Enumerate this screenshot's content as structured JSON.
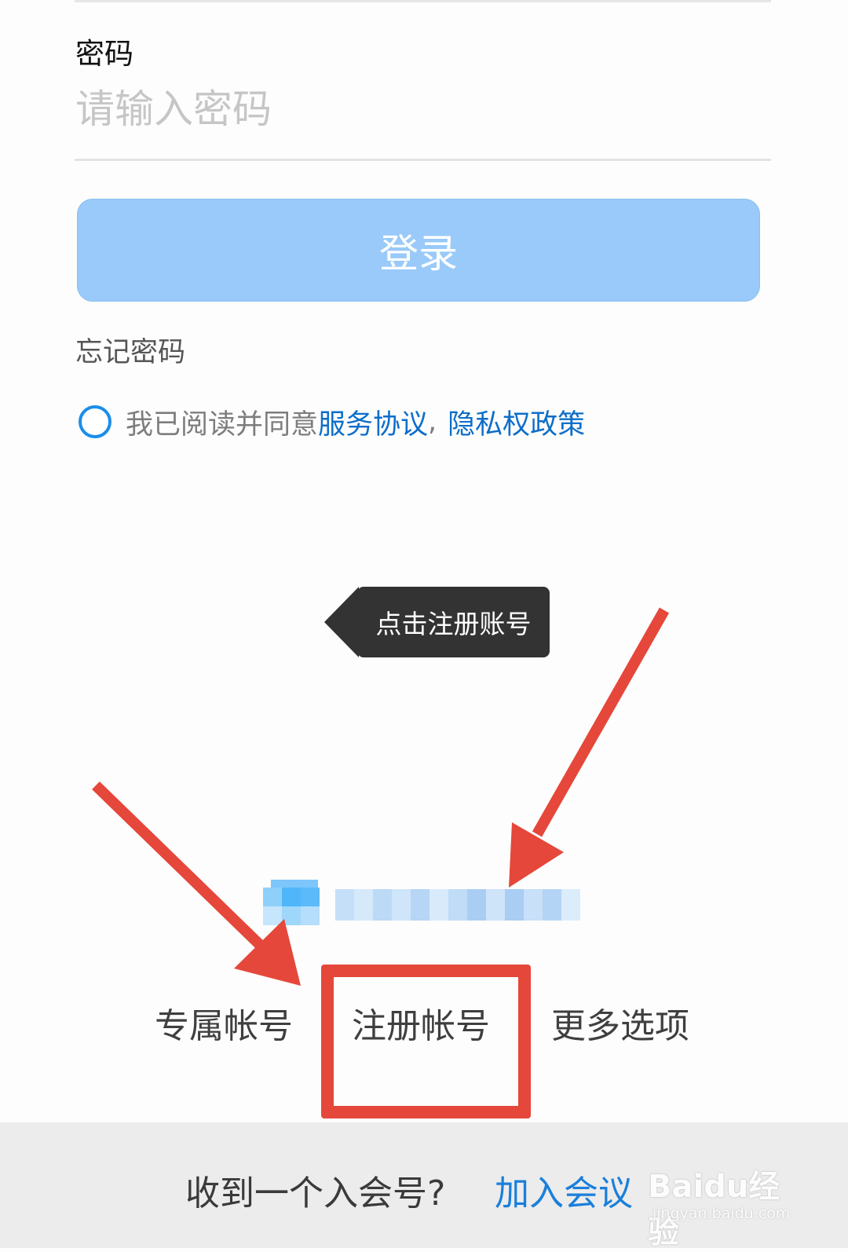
{
  "password": {
    "label": "密码",
    "placeholder": "请输入密码",
    "value": ""
  },
  "login_button": {
    "label": "登录"
  },
  "forgot_password": {
    "label": "忘记密码"
  },
  "agreement": {
    "prefix": "我已阅读并同意",
    "service_link": "服务协议",
    "separator": ",",
    "privacy_link": "隐私权政策",
    "checked": false
  },
  "tooltip": {
    "text": "点击注册账号"
  },
  "options": {
    "exclusive_account": "专属帐号",
    "register_account": "注册帐号",
    "more_options": "更多选项"
  },
  "join": {
    "question": "收到一个入会号?",
    "link": "加入会议"
  },
  "watermark": {
    "logo": "Baidu经验",
    "url": "jingyan.baidu.com"
  },
  "colors": {
    "login_button": "#99caf9",
    "link_blue": "#0d6ec9",
    "join_blue": "#1a7fdb",
    "annotation_red": "#e5473a",
    "tooltip_bg": "#333333"
  },
  "icons": {
    "radio": "radio-unchecked-icon",
    "annotation": "red-arrow-icon"
  }
}
